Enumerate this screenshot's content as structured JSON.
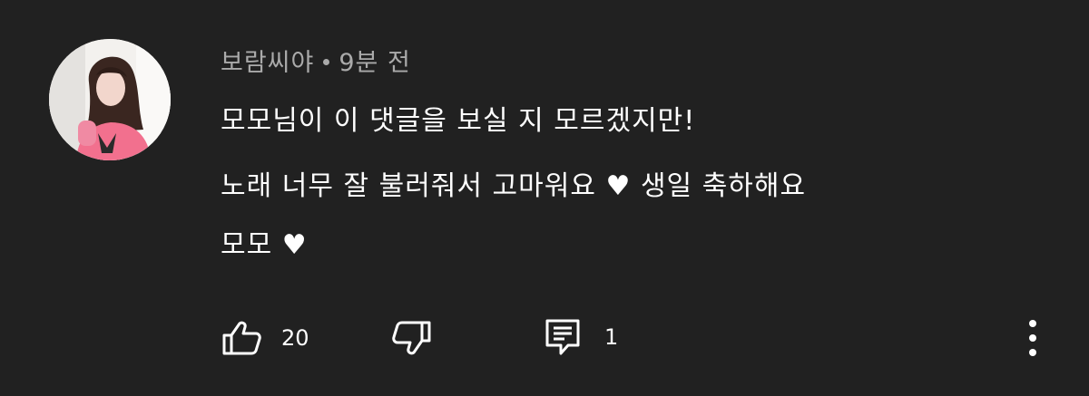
{
  "comment": {
    "author": "보람씨야",
    "time": "9분 전",
    "lines": [
      "모모님이 이 댓글을 보실 지 모르겠지만!",
      "노래 너무 잘 불러줘서 고마워요",
      "생일 축하해요",
      "모모"
    ],
    "heart_glyph": "♥"
  },
  "actions": {
    "like_count": "20",
    "reply_count": "1",
    "icons": {
      "like": "thumbs-up-icon",
      "dislike": "thumbs-down-icon",
      "reply": "reply-icon",
      "more": "more-vertical-icon"
    }
  },
  "colors": {
    "background": "#212121",
    "text": "#ffffff",
    "meta": "#aaaaaa"
  }
}
